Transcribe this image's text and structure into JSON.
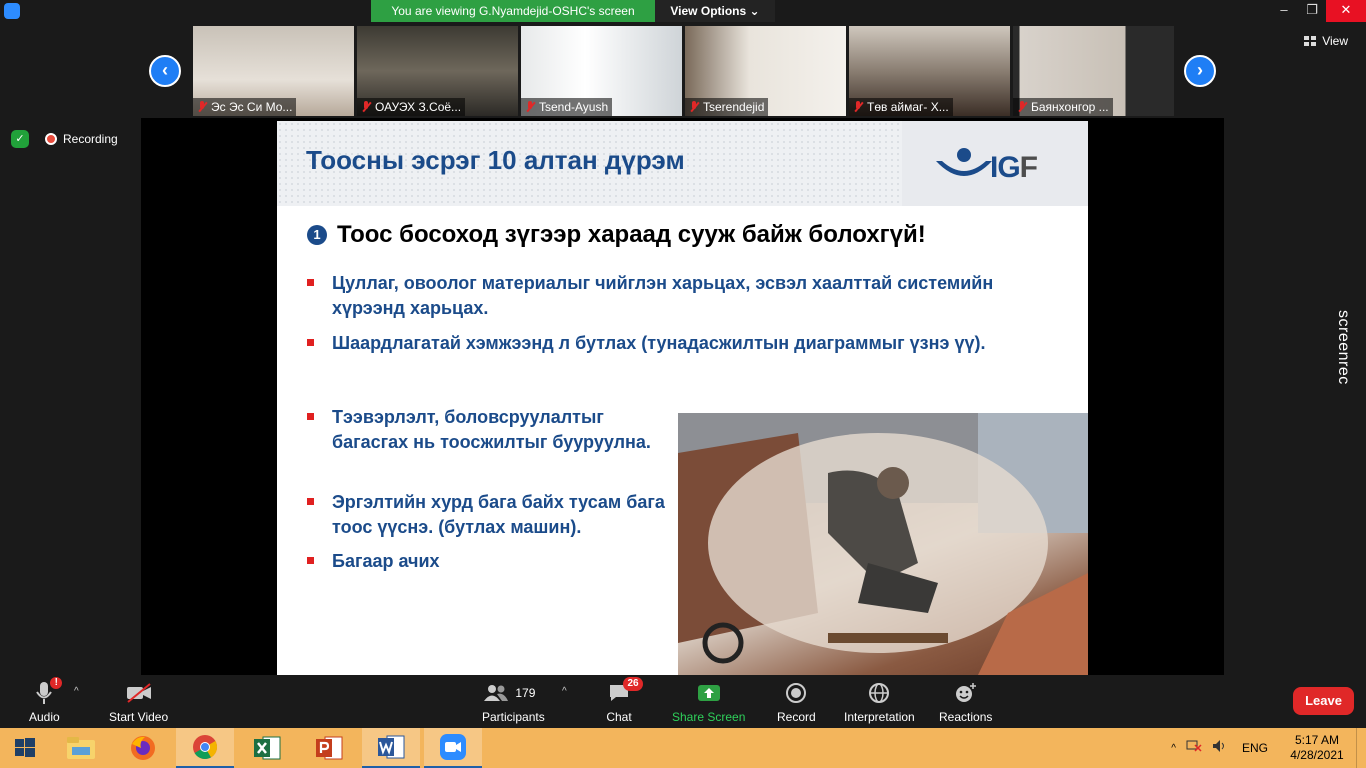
{
  "banner": {
    "viewing_text": "You are viewing G.Nyamdejid-OSHC's screen",
    "view_options": "View Options"
  },
  "window": {
    "minimize": "–",
    "maximize": "❐",
    "close": "✕"
  },
  "view_button": "View",
  "participants_strip": [
    {
      "name": "Эс Эс Си Мо..."
    },
    {
      "name": "ОАУЭХ З.Соё..."
    },
    {
      "name": "Tsend-Ayush"
    },
    {
      "name": "Tserendejid"
    },
    {
      "name": "Төв аймаг- Х..."
    },
    {
      "name": "Баянхонгор ..."
    }
  ],
  "recording": {
    "label": "Recording"
  },
  "watermark": "screenrec",
  "slide": {
    "title": "Тоосны эсрэг 10 алтан дүрэм",
    "logo_text_a": "IG",
    "logo_text_b": "F",
    "number": "1",
    "headline": "Тоос босоход зүгээр хараад сууж байж болохгүй!",
    "bullets": [
      "Цуллаг, овоолог материалыг чийглэн харьцах, эсвэл хаалттай системийн хүрээнд харьцах.",
      "Шаардлагатай хэмжээнд л бутлах (тунадасжилтын диаграммыг үзнэ үү).",
      "Тээвэрлэлт, боловсруулалтыг багасгах нь тоосжилтыг бууруулна.",
      "Эргэлтийн хурд бага байх тусам бага тоос үүснэ. (бутлах машин).",
      "Багаар ачих"
    ]
  },
  "toolbar": {
    "audio": "Audio",
    "audio_badge": "!",
    "start_video": "Start Video",
    "participants": "Participants",
    "participants_count": "179",
    "chat": "Chat",
    "chat_badge": "26",
    "share_screen": "Share Screen",
    "record": "Record",
    "interpretation": "Interpretation",
    "reactions": "Reactions",
    "leave": "Leave"
  },
  "taskbar": {
    "language": "ENG",
    "time": "5:17 AM",
    "date": "4/28/2021"
  },
  "colors": {
    "accent_green": "#2ea043",
    "zoom_blue": "#2d8cff",
    "leave_red": "#e02828",
    "slide_blue": "#1b4b8a"
  }
}
